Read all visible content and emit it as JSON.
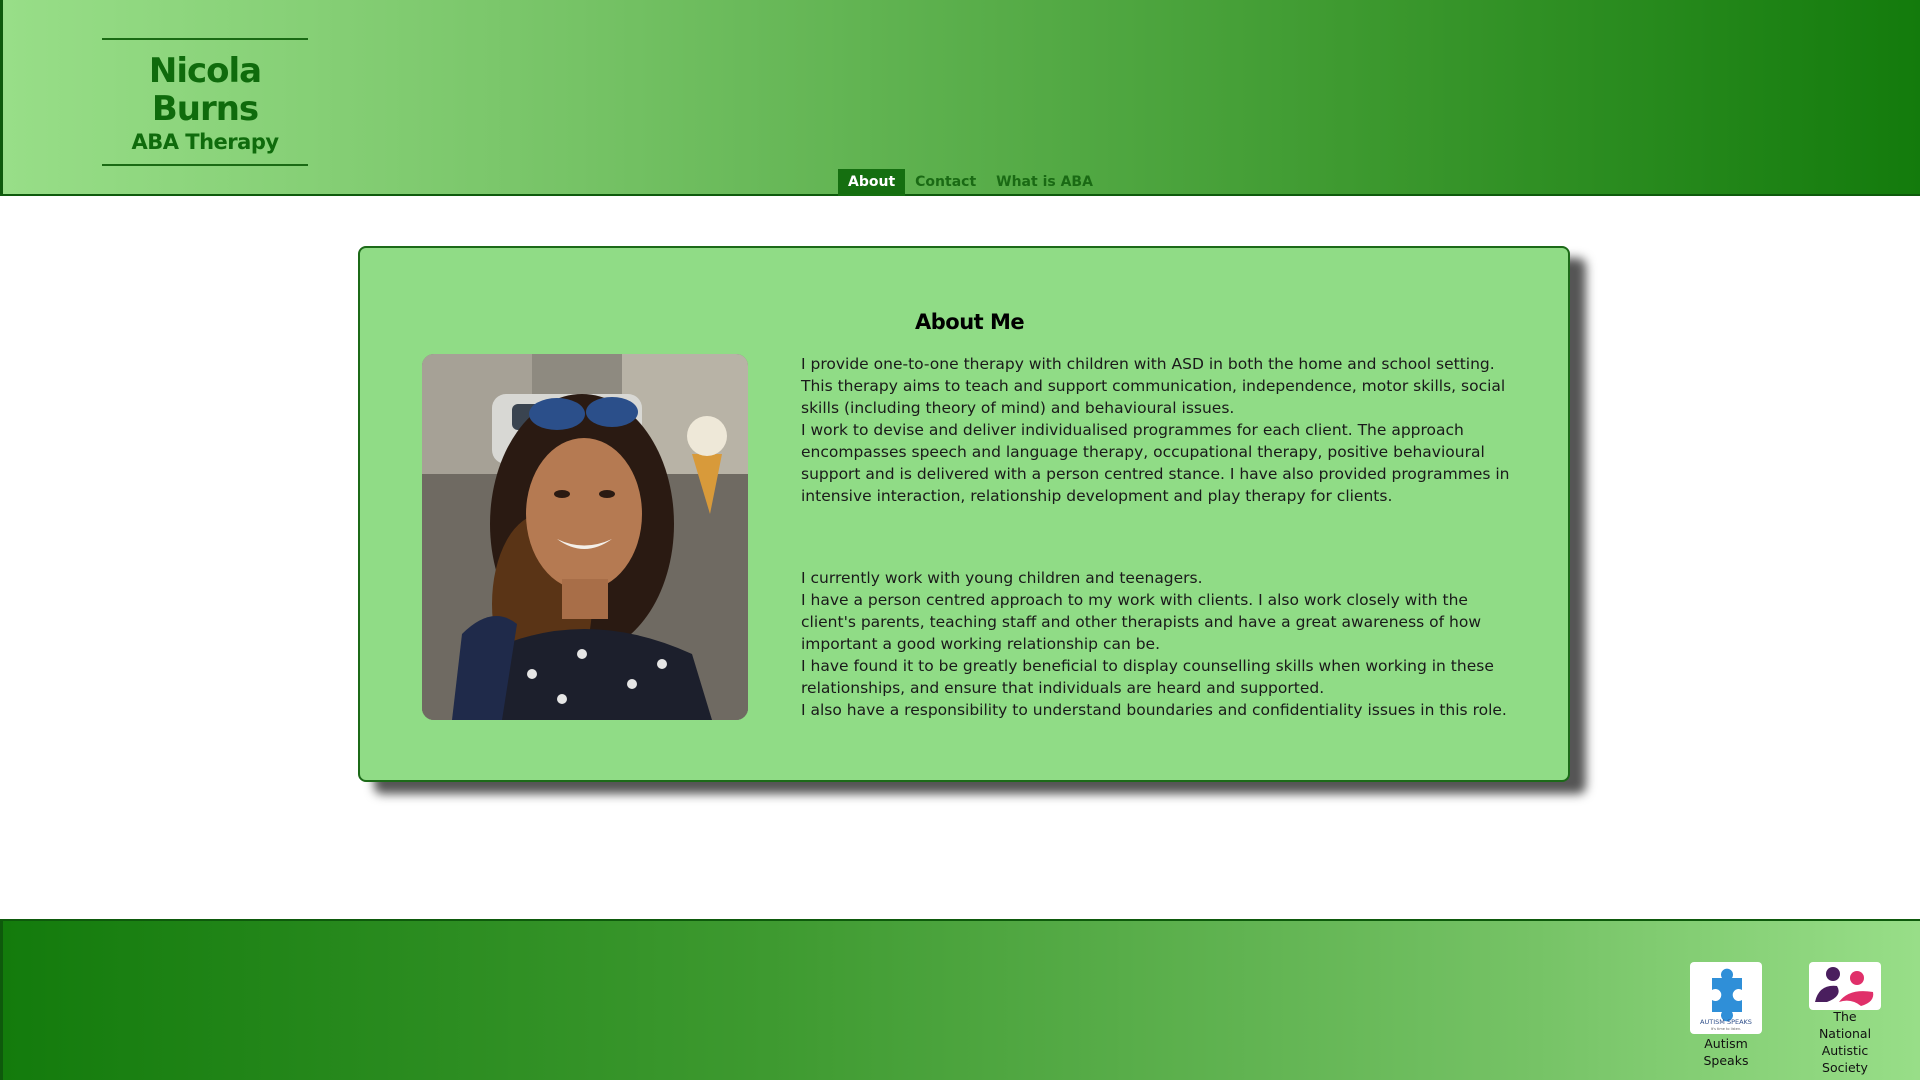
{
  "header": {
    "brand_name": "Nicola Burns",
    "brand_subtitle": "ABA Therapy",
    "nav": [
      {
        "label": "About",
        "active": true
      },
      {
        "label": "Contact",
        "active": false
      },
      {
        "label": "What is ABA",
        "active": false
      }
    ]
  },
  "main": {
    "title": "About Me",
    "photo_icon": "portrait-photo",
    "paragraphs_1": [
      "I provide one-to-one therapy with children with ASD in both the home and school setting. This therapy aims to teach and support communication, independence, motor skills, social skills (including theory of mind) and behavioural issues.",
      "I work to devise and deliver individualised programmes for each client. The approach encompasses speech and language therapy, occupational therapy, positive behavioural support and is delivered with a person centred stance. I have also provided programmes in intensive interaction, relationship development and play therapy for clients."
    ],
    "paragraphs_2": [
      "I currently work with young children and teenagers.",
      "I have a person centred approach to my work with clients. I also work closely with the client's parents, teaching staff and other therapists and have a great awareness of how important a good working relationship can be.",
      "I have found it to be greatly beneficial to display counselling skills when working in these relationships, and ensure that individuals are heard and supported.",
      "I also have a responsibility to understand boundaries and confidentiality issues in this role."
    ]
  },
  "footer": {
    "partners": [
      {
        "label": "Autism Speaks",
        "logo_text": "AUTISM SPEAKS",
        "logo_tagline": "It's time to listen.",
        "icon": "puzzle-piece-icon"
      },
      {
        "label": "The National Autistic Society",
        "icon": "nas-logo-icon"
      }
    ]
  },
  "colors": {
    "header_light": "#98de88",
    "header_dark": "#137b0c",
    "card_bg": "#90dc86",
    "nav_active_bg": "#156f10",
    "brand_text": "#0f6b0c"
  }
}
